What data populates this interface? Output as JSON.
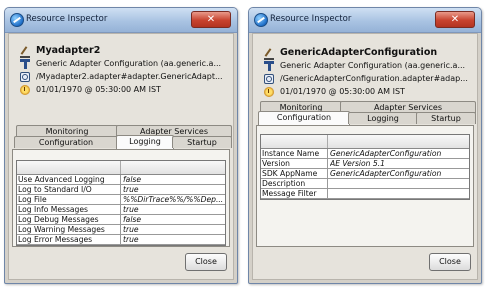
{
  "windows": [
    {
      "title": "Resource Inspector",
      "close_symbol": "✕",
      "name": "Myadapter2",
      "type_line": "Generic Adapter Configuration (aa.generic.a...",
      "path_line": "/Myadapter2.adapter#adapter.GenericAdapt...",
      "date_line": "01/01/1970 @ 05:30:00 AM IST",
      "tabs_back": [
        "Monitoring",
        "Adapter Services"
      ],
      "tabs_front": [
        "Configuration",
        "Logging",
        "Startup"
      ],
      "selected_tab": "Logging",
      "rows": [
        {
          "key": "Use Advanced Logging",
          "value": "false"
        },
        {
          "key": "Log to Standard I/O",
          "value": "true"
        },
        {
          "key": "Log File",
          "value": "%%DirTrace%%/%%Dep..."
        },
        {
          "key": "Log Info Messages",
          "value": "true"
        },
        {
          "key": "Log Debug Messages",
          "value": "false"
        },
        {
          "key": "Log Warning Messages",
          "value": "true"
        },
        {
          "key": "Log Error Messages",
          "value": "true"
        }
      ],
      "close_button": "Close"
    },
    {
      "title": "Resource Inspector",
      "close_symbol": "✕",
      "name": "GenericAdapterConfiguration",
      "type_line": "Generic Adapter Configuration (aa.generic.a...",
      "path_line": "/GenericAdapterConfiguration.adapter#adap...",
      "date_line": "01/01/1970 @ 05:30:00 AM IST",
      "tabs_back": [
        "Monitoring",
        "Adapter Services"
      ],
      "tabs_front": [
        "Configuration",
        "Logging",
        "Startup"
      ],
      "selected_tab": "Configuration",
      "rows": [
        {
          "key": "Instance Name",
          "value": "GenericAdapterConfiguration"
        },
        {
          "key": "Version",
          "value": "AE Version 5.1"
        },
        {
          "key": "SDK AppName",
          "value": "GenericAdapterConfiguration"
        },
        {
          "key": "Description",
          "value": ""
        },
        {
          "key": "Message Filter",
          "value": ""
        }
      ],
      "close_button": "Close"
    }
  ]
}
